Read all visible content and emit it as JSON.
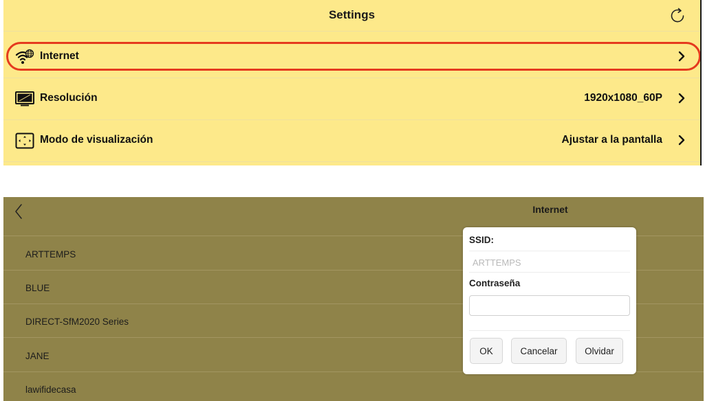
{
  "settings": {
    "title": "Settings",
    "refresh_icon": "refresh-icon",
    "rows": [
      {
        "icon": "wifi-globe-icon",
        "label": "Internet",
        "value": "",
        "highlighted": true
      },
      {
        "icon": "monitor-icon",
        "label": "Resolución",
        "value": "1920x1080_60P"
      },
      {
        "icon": "display-mode-icon",
        "label": "Modo de visualización",
        "value": "Ajustar a la pantalla"
      }
    ],
    "colors": {
      "background": "#fde98a",
      "highlight_ring": "#e53a1e"
    }
  },
  "internet": {
    "title": "Internet",
    "back_icon": "chevron-left-icon",
    "networks": [
      "ARTTEMPS",
      "BLUE",
      "DIRECT-SfM2020 Series",
      "JANE",
      "lawifidecasa"
    ],
    "colors": {
      "background": "#8f8349"
    }
  },
  "dialog": {
    "ssid_label": "SSID:",
    "ssid_value": "ARTTEMPS",
    "password_label": "Contraseña",
    "password_value": "",
    "buttons": {
      "ok": "OK",
      "cancel": "Cancelar",
      "forget": "Olvidar"
    }
  }
}
